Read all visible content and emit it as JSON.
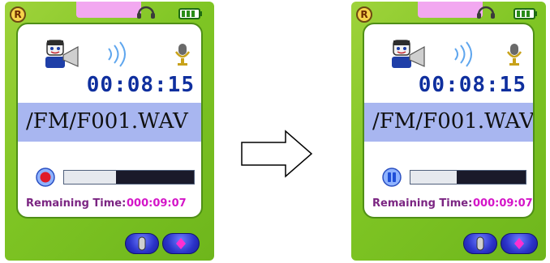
{
  "devices": [
    {
      "badge_letter": "R",
      "time": "00:08:15",
      "path": "/FM/F001.WAV",
      "remaining_label": "Remaining Time:",
      "remaining_value": "000:09:07",
      "status_icon": "record-icon",
      "progress": 0.4
    },
    {
      "badge_letter": "R",
      "time": "00:08:15",
      "path": "/FM/F001.WAV",
      "remaining_label": "Remaining Time:",
      "remaining_value": "000:09:07",
      "status_icon": "pause-icon",
      "progress": 0.4
    }
  ],
  "icons": {
    "left_top": "r-badge-icon",
    "headphones": "headphone-icon",
    "battery": "battery-icon",
    "presenter": "presenter-icon",
    "waves": "sound-waves-icon",
    "mic": "microphone-icon",
    "transition_arrow": "right-arrow-icon"
  },
  "colors": {
    "frame_green": "#7fc524",
    "path_bar": "#a8b6f0",
    "time_text": "#0f2f9e",
    "remaining_label": "#7b2582",
    "remaining_value": "#d415c8",
    "button_blue": "#2b33c9",
    "record_red": "#e01c2a",
    "pink_tab": "#f2a8f0"
  }
}
